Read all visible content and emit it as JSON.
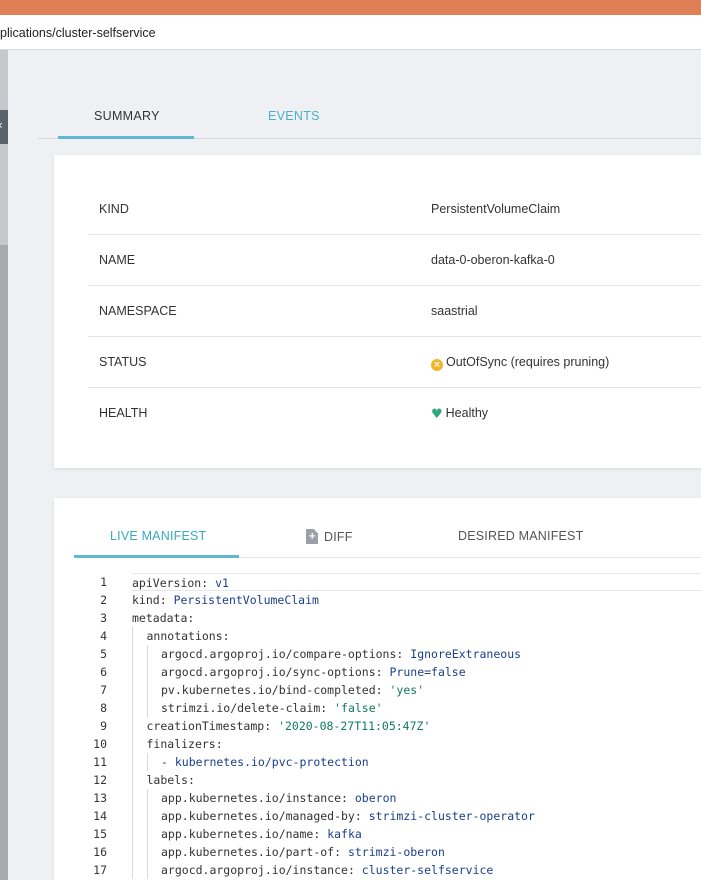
{
  "browser": {
    "url": "plications/cluster-selfservice"
  },
  "tabs": {
    "summary": "SUMMARY",
    "events": "EVENTS"
  },
  "summary": {
    "rows": [
      {
        "key": "KIND",
        "value": "PersistentVolumeClaim"
      },
      {
        "key": "NAME",
        "value": "data-0-oberon-kafka-0"
      },
      {
        "key": "NAMESPACE",
        "value": "saastrial"
      },
      {
        "key": "STATUS",
        "value": "OutOfSync (requires pruning)",
        "icon": "warning-circle-icon",
        "color": "#f0b429"
      },
      {
        "key": "HEALTH",
        "value": "Healthy",
        "icon": "heart-icon",
        "color": "#2ea87a"
      }
    ]
  },
  "manifest": {
    "tabs": {
      "live": "LIVE MANIFEST",
      "diff": "DIFF",
      "desired": "DESIRED MANIFEST"
    },
    "lines": [
      {
        "n": "1",
        "indent": 0,
        "key": "apiVersion",
        "value": "v1",
        "vtype": "v"
      },
      {
        "n": "2",
        "indent": 0,
        "key": "kind",
        "value": "PersistentVolumeClaim",
        "vtype": "v"
      },
      {
        "n": "3",
        "indent": 0,
        "key": "metadata",
        "value": "",
        "vtype": "v"
      },
      {
        "n": "4",
        "indent": 1,
        "key": "annotations",
        "value": "",
        "vtype": "v"
      },
      {
        "n": "5",
        "indent": 2,
        "key": "argocd.argoproj.io/compare-options",
        "value": "IgnoreExtraneous",
        "vtype": "v"
      },
      {
        "n": "6",
        "indent": 2,
        "key": "argocd.argoproj.io/sync-options",
        "value": "Prune=false",
        "vtype": "v"
      },
      {
        "n": "7",
        "indent": 2,
        "key": "pv.kubernetes.io/bind-completed",
        "value": "'yes'",
        "vtype": "s"
      },
      {
        "n": "8",
        "indent": 2,
        "key": "strimzi.io/delete-claim",
        "value": "'false'",
        "vtype": "s"
      },
      {
        "n": "9",
        "indent": 1,
        "key": "creationTimestamp",
        "value": "'2020-08-27T11:05:47Z'",
        "vtype": "s"
      },
      {
        "n": "10",
        "indent": 1,
        "key": "finalizers",
        "value": "",
        "vtype": "v"
      },
      {
        "n": "11",
        "indent": 2,
        "key": "",
        "value": "- kubernetes.io/pvc-protection",
        "vtype": "v"
      },
      {
        "n": "12",
        "indent": 1,
        "key": "labels",
        "value": "",
        "vtype": "v"
      },
      {
        "n": "13",
        "indent": 2,
        "key": "app.kubernetes.io/instance",
        "value": "oberon",
        "vtype": "v"
      },
      {
        "n": "14",
        "indent": 2,
        "key": "app.kubernetes.io/managed-by",
        "value": "strimzi-cluster-operator",
        "vtype": "v"
      },
      {
        "n": "15",
        "indent": 2,
        "key": "app.kubernetes.io/name",
        "value": "kafka",
        "vtype": "v"
      },
      {
        "n": "16",
        "indent": 2,
        "key": "app.kubernetes.io/part-of",
        "value": "strimzi-oberon",
        "vtype": "v"
      },
      {
        "n": "17",
        "indent": 2,
        "key": "argocd.argoproj.io/instance",
        "value": "cluster-selfservice",
        "vtype": "v"
      }
    ]
  }
}
